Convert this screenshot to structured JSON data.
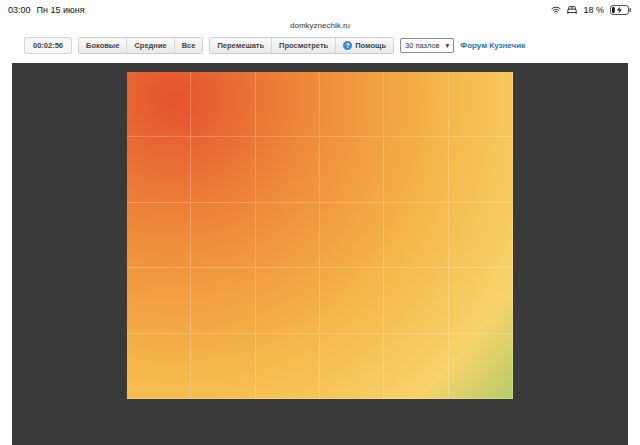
{
  "status_bar": {
    "time": "03:00",
    "date": "Пн 15 июня",
    "battery": "18 %",
    "battery_level": 0.18,
    "charging": true
  },
  "address_bar": {
    "url": "domkyznechik.ru"
  },
  "toolbar": {
    "timer": "00:02:56",
    "filters": [
      {
        "label": "Боковые",
        "selected": false
      },
      {
        "label": "Средние",
        "selected": false
      },
      {
        "label": "Все",
        "selected": false
      }
    ],
    "actions": [
      "Перемешать",
      "Просмотреть"
    ],
    "help": {
      "icon": "?",
      "label": "Помощь"
    },
    "pieces_select": {
      "value": "30 пазлов",
      "icon": "▾"
    },
    "forum_link": "Форум Кузнечик"
  },
  "puzzle": {
    "columns": 6,
    "rows": 5
  }
}
